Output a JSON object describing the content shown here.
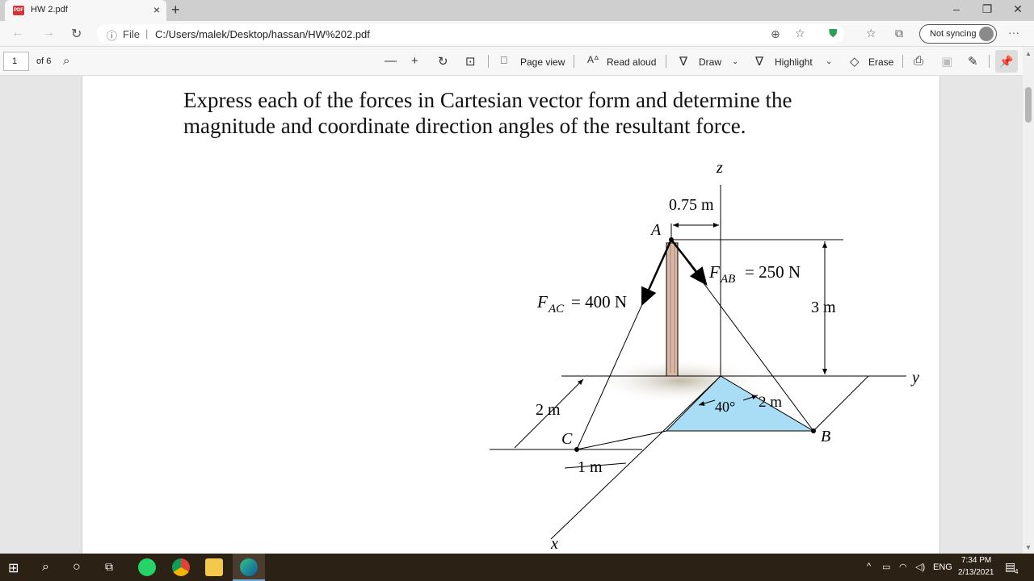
{
  "browser": {
    "tab_title": "HW 2.pdf",
    "tab_icon_text": "PDF",
    "tab_close": "×",
    "new_tab": "+",
    "win_min": "–",
    "win_max": "❐",
    "win_close": "✕",
    "url_scheme": "File",
    "url": "C:/Users/malek/Desktop/hassan/HW%202.pdf",
    "sync_label": "Not syncing",
    "more": "···"
  },
  "pdf_toolbar": {
    "page_number": "1",
    "page_count": "of 6",
    "page_view": "Page view",
    "read_aloud": "Read aloud",
    "draw": "Draw",
    "highlight": "Highlight",
    "erase": "Erase"
  },
  "document": {
    "problem_text": "Express each of the forces in Cartesian vector form and determine the magnitude and coordinate direction angles of the resultant force.",
    "figure": {
      "axis_z": "z",
      "axis_y": "y",
      "axis_x": "x",
      "point_a": "A",
      "point_b": "B",
      "point_c": "C",
      "dim_075": "0.75 m",
      "dim_3m": "3 m",
      "dim_2m_left": "2 m",
      "dim_1m": "1 m",
      "dim_2m_right": "2 m",
      "angle": "40°",
      "force_ab_sym": "F",
      "force_ab_sub": "AB",
      "force_ab_val": "= 250 N",
      "force_ac_sym": "F",
      "force_ac_sub": "AC",
      "force_ac_val": "= 400 N"
    }
  },
  "taskbar": {
    "lang": "ENG",
    "time": "7:34 PM",
    "date": "2/13/2021",
    "notif_count": "4"
  },
  "colors": {
    "edge_accent": "#0078d4",
    "triangle_fill": "#a9dcf5",
    "post_fill": "#d9b9a6",
    "taskbar": "#2b2114"
  }
}
